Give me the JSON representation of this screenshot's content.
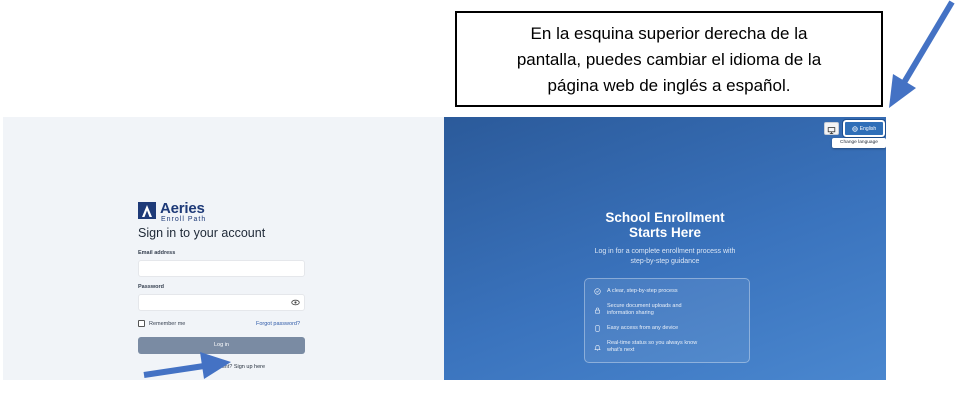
{
  "callout": {
    "line1": "En la esquina superior derecha de la",
    "line2": "pantalla, puedes cambiar el idioma de la",
    "line3": "página web de inglés a español."
  },
  "brand": {
    "name": "Aeries",
    "sub": "Enroll Path"
  },
  "login": {
    "title": "Sign in to your account",
    "email_label": "Email address",
    "email_value": "",
    "password_label": "Password",
    "password_value": "",
    "remember_label": "Remember me",
    "forgot_label": "Forgot password?",
    "login_button": "Log in",
    "signup_prefix": "account?",
    "signup_link": "Sign up here"
  },
  "topbar": {
    "language_button": "English",
    "tooltip": "Change language",
    "display_icon": "monitor-icon",
    "language_icon": "globe-icon"
  },
  "hero": {
    "title_line1": "School Enrollment",
    "title_line2": "Starts Here",
    "subtitle_line1": "Log in for a complete enrollment process with",
    "subtitle_line2": "step-by-step guidance",
    "features": [
      {
        "icon": "check-circle-icon",
        "line1": "A clear, step-by-step process",
        "line2": ""
      },
      {
        "icon": "lock-icon",
        "line1": "Secure document uploads and",
        "line2": "information sharing"
      },
      {
        "icon": "phone-icon",
        "line1": "Easy access from any device",
        "line2": ""
      },
      {
        "icon": "bell-icon",
        "line1": "Real-time status so you always know",
        "line2": "what's next"
      }
    ]
  },
  "colors": {
    "brand": "#1e3a78",
    "hero_bg": "#3a73bd",
    "login_button": "#7a8ba3",
    "arrow": "#4472c4"
  }
}
